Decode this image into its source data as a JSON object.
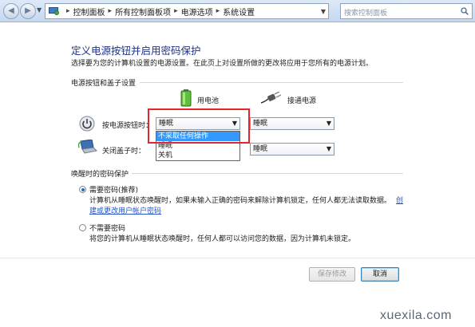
{
  "address_bar": {
    "crumbs": [
      "控制面板",
      "所有控制面板项",
      "电源选项",
      "系统设置"
    ],
    "search_placeholder": "搜索控制面板"
  },
  "page": {
    "title": "定义电源按钮并启用密码保护",
    "description": "选择要为您的计算机设置的电源设置。在此页上对设置所做的更改将应用于您所有的电源计划。"
  },
  "power_section": {
    "heading": "电源按钮和盖子设置",
    "col_battery": "用电池",
    "col_plugged": "接通电源",
    "power_button_label": "按电源按钮时：",
    "power_button_battery_value": "睡眠",
    "power_button_plugged_value": "睡眠",
    "lid_label": "关闭盖子时：",
    "lid_plugged_value": "睡眠",
    "dropdown_options": [
      "不采取任何操作",
      "睡眠",
      "关机"
    ]
  },
  "password_section": {
    "heading": "唤醒时的密码保护",
    "require_label": "需要密码(推荐)",
    "require_desc_1": "计算机从睡眠状态唤醒时，如果未输入正确的密码来解除计算机锁定，任何人都无法读取数据。",
    "require_link_1": "创",
    "require_link_2": "建或更改用户帐户密码",
    "norequire_label": "不需要密码",
    "norequire_desc": "将您的计算机从睡眠状态唤醒时，任何人都可以访问您的数据，因为计算机未锁定。"
  },
  "buttons": {
    "save": "保存修改",
    "cancel": "取消"
  },
  "watermark": "xuexila.com"
}
